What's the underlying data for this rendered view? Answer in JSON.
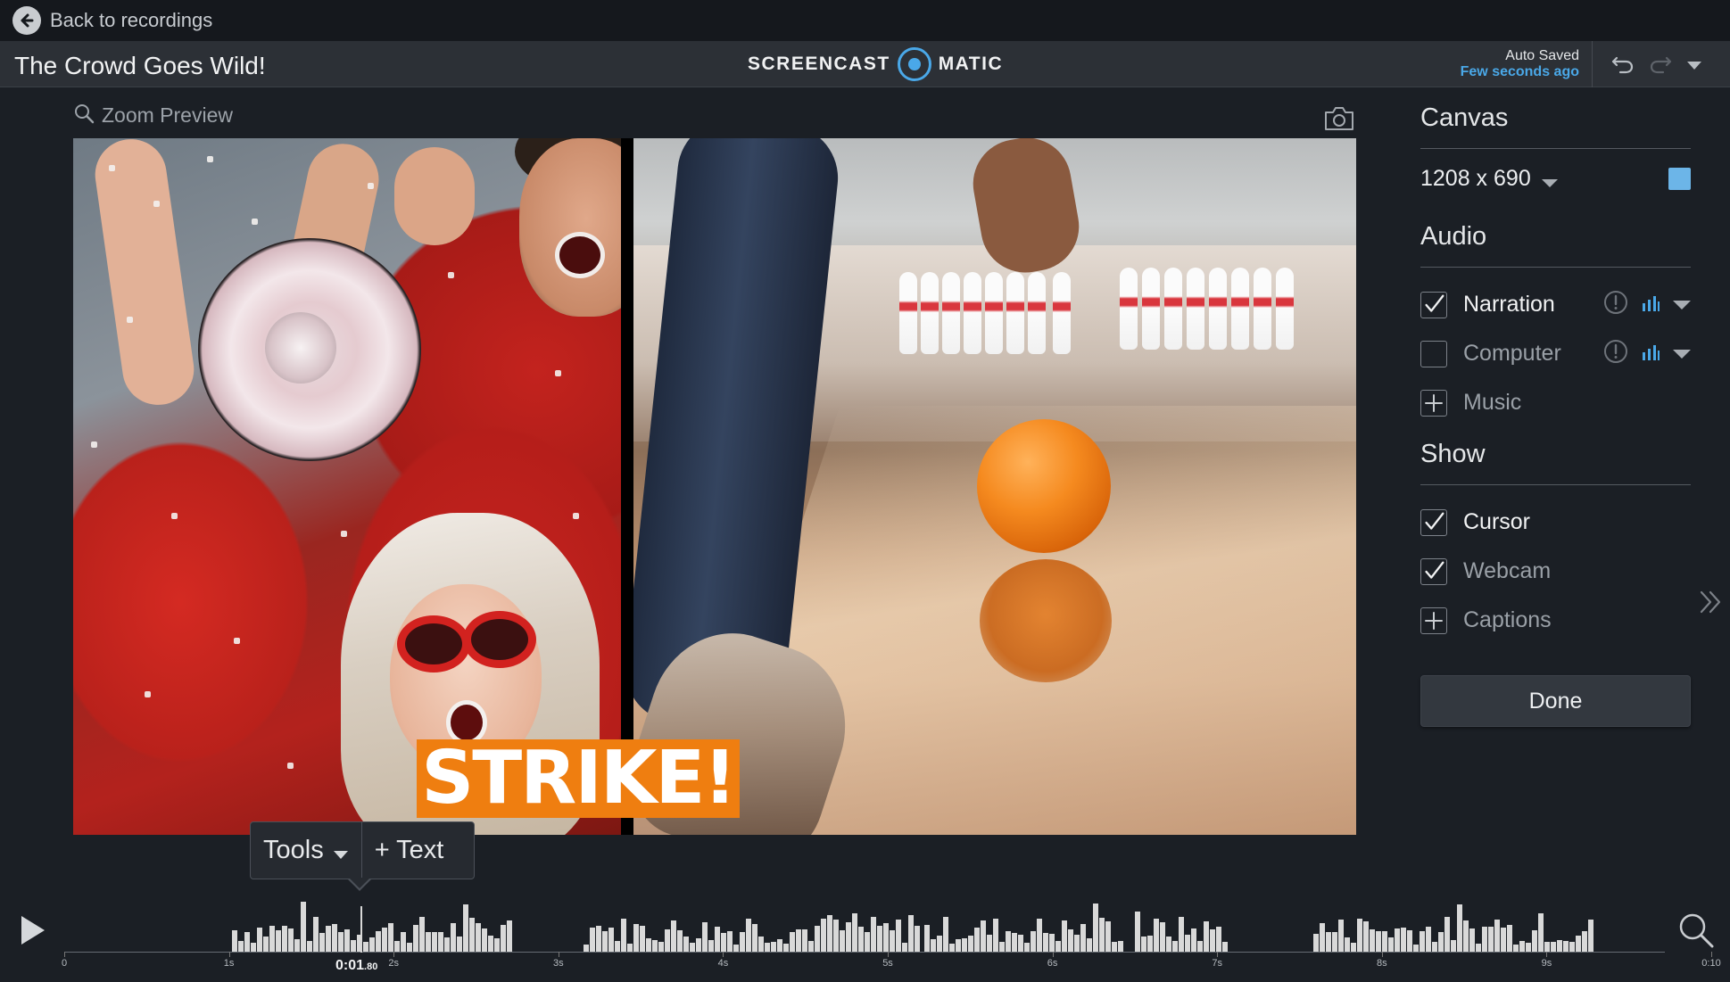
{
  "nav": {
    "back_label": "Back to recordings"
  },
  "header": {
    "title": "The Crowd Goes Wild!",
    "logo_left": "SCREENCAST",
    "logo_right": "MATIC",
    "saved_status": "Auto Saved",
    "saved_time": "Few seconds ago"
  },
  "preview": {
    "zoom_label": "Zoom Preview",
    "overlay_text": "STRIKE!"
  },
  "tools_popup": {
    "tools_label": "Tools",
    "text_label": "+ Text"
  },
  "timeline": {
    "current_time": "0:01",
    "current_time_fraction": ".80",
    "tick_labels": [
      "0",
      "1s",
      "2s",
      "3s",
      "4s",
      "5s",
      "6s",
      "7s",
      "8s",
      "9s",
      "0:10"
    ]
  },
  "side": {
    "canvas": {
      "title": "Canvas",
      "size": "1208 x 690",
      "color": "#6cb5e8"
    },
    "audio": {
      "title": "Audio",
      "items": [
        {
          "label": "Narration",
          "checked": true
        },
        {
          "label": "Computer",
          "checked": false
        },
        {
          "label": "Music",
          "add": true
        }
      ]
    },
    "show": {
      "title": "Show",
      "items": [
        {
          "label": "Cursor",
          "checked": true
        },
        {
          "label": "Webcam",
          "checked": true
        },
        {
          "label": "Captions",
          "add": true
        }
      ]
    },
    "done_label": "Done"
  },
  "colors": {
    "accent": "#4aa8e8",
    "overlay": "#ef7e10"
  }
}
